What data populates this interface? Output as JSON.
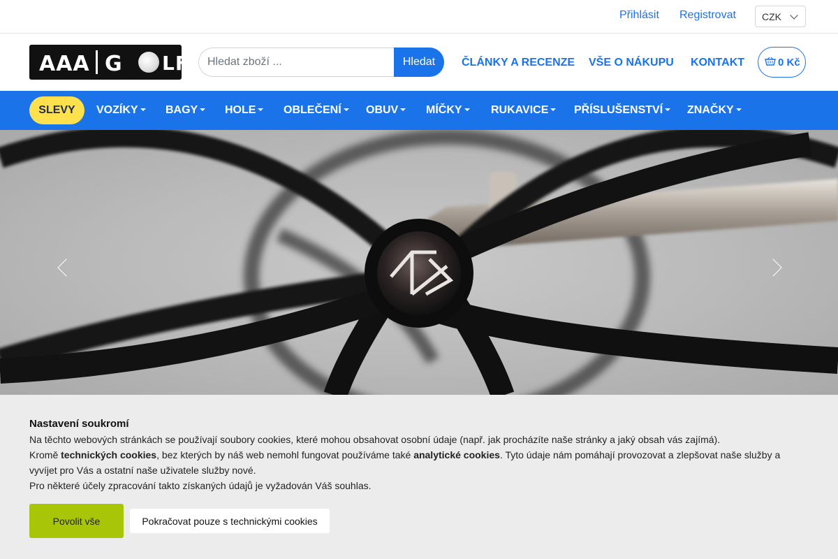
{
  "topbar": {
    "login": "Přihlásit",
    "register": "Registrovat",
    "currency": "CZK"
  },
  "header": {
    "logo_text": "AAA GOLF",
    "search_placeholder": "Hledat zboží ...",
    "search_button": "Hledat",
    "nav": [
      "ČLÁNKY A RECENZE",
      "VŠE O NÁKUPU",
      "KONTAKT"
    ],
    "cart_total": "0 Kč",
    "cart_icon": "basket-icon"
  },
  "categories": {
    "sale": "SLEVY",
    "items": [
      "VOZÍKY",
      "BAGY",
      "HOLE",
      "OBLEČENÍ",
      "OBUV",
      "MÍČKY",
      "RUKAVICE",
      "PŘÍSLUŠENSTVÍ",
      "ZNAČKY"
    ]
  },
  "hero": {
    "prev_icon": "chevron-left-icon",
    "next_icon": "chevron-right-icon"
  },
  "cookie": {
    "title": "Nastavení soukromí",
    "p1": "Na těchto webových stránkách se používají soubory cookies, které mohou obsahovat osobní údaje (např. jak procházíte naše stránky a jaký obsah vás zajímá).",
    "p2_a": "Kromě ",
    "p2_b": "technických cookies",
    "p2_c": ", bez kterých by náš web nemohl fungovat používáme také ",
    "p2_d": "analytické cookies",
    "p2_e": ". Tyto údaje nám pomáhají provozovat a zlepšovat naše služby a vyvíjet pro Vás a ostatní naše uživatele služby nové.",
    "p3": "Pro některé účely zpracování takto získaných údajů je vyžadován Váš souhlas.",
    "accept_all": "Povolit vše",
    "tech_only": "Pokračovat pouze s technickými cookies"
  },
  "colors": {
    "primary": "#1a73e8",
    "sale_bg": "#ffe14d",
    "accept_bg": "#a8c507"
  }
}
